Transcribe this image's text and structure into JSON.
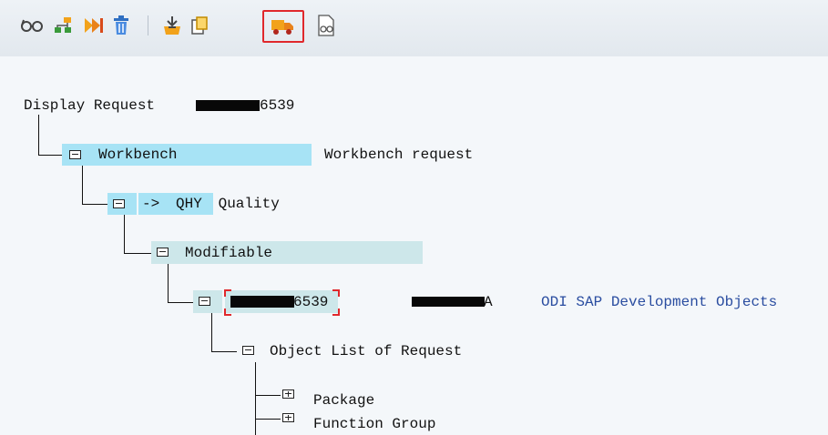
{
  "toolbar": {
    "buttons": [
      {
        "icon": "glasses-display-icon",
        "label": ""
      },
      {
        "icon": "hierarchy-icon",
        "label": ""
      },
      {
        "icon": "forward-arrows-icon",
        "label": ""
      },
      {
        "icon": "trash-icon",
        "label": ""
      },
      {
        "icon": "release-inbox-icon",
        "label": ""
      },
      {
        "icon": "copy-document-icon",
        "label": ""
      },
      {
        "icon": "transport-truck-icon",
        "label": ""
      },
      {
        "icon": "document-glasses-icon",
        "label": ""
      }
    ],
    "selected_button": "transport-truck-icon",
    "colors": {
      "accent_red": "#e0282c",
      "icon_orange": "#f2a21a",
      "icon_blue": "#2f6fc2",
      "icon_green": "#3a9a3a"
    }
  },
  "tree": {
    "root": {
      "label_prefix": "Display Request ",
      "label_suffix": "6539"
    },
    "workbench": {
      "label": "Workbench",
      "description": "Workbench request"
    },
    "target": {
      "label_arrow": "-> ",
      "label_sys": "QHY",
      "label_rest": " Quality"
    },
    "status": {
      "label": "Modifiable"
    },
    "task": {
      "id_suffix": "6539",
      "owner_suffix": "A",
      "description": "ODI SAP Development Objects"
    },
    "object_list": {
      "label": "Object List of Request"
    },
    "children": [
      {
        "label": "Package"
      },
      {
        "label": "Function Group"
      }
    ]
  },
  "colors": {
    "highlight_blue": "#a7e3f5",
    "highlight_teal": "#cde7ea",
    "desc_blue": "#2a4da0"
  }
}
